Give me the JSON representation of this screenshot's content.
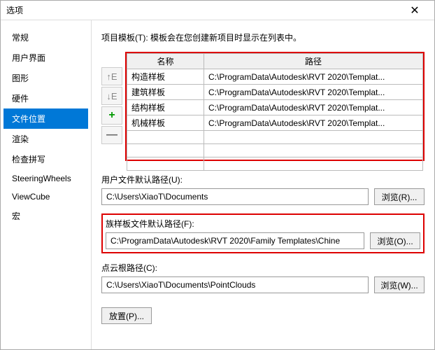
{
  "title": "选项",
  "sidebar": {
    "items": [
      {
        "label": "常规"
      },
      {
        "label": "用户界面"
      },
      {
        "label": "图形"
      },
      {
        "label": "硬件"
      },
      {
        "label": "文件位置"
      },
      {
        "label": "渲染"
      },
      {
        "label": "检查拼写"
      },
      {
        "label": "SteeringWheels"
      },
      {
        "label": "ViewCube"
      },
      {
        "label": "宏"
      }
    ]
  },
  "heading": "项目模板(T): 模板会在您创建新项目时显示在列表中。",
  "table": {
    "col_name": "名称",
    "col_path": "路径",
    "rows": [
      {
        "name": "构造样板",
        "path": "C:\\ProgramData\\Autodesk\\RVT 2020\\Templat..."
      },
      {
        "name": "建筑样板",
        "path": "C:\\ProgramData\\Autodesk\\RVT 2020\\Templat..."
      },
      {
        "name": "结构样板",
        "path": "C:\\ProgramData\\Autodesk\\RVT 2020\\Templat..."
      },
      {
        "name": "机械样板",
        "path": "C:\\ProgramData\\Autodesk\\RVT 2020\\Templat..."
      }
    ]
  },
  "buttons": {
    "up": "↑E",
    "down": "↓E",
    "add": "+",
    "remove": "—"
  },
  "user_path": {
    "label": "用户文件默认路径(U):",
    "value": "C:\\Users\\XiaoT\\Documents",
    "browse": "浏览(R)..."
  },
  "family_path": {
    "label": "族样板文件默认路径(F):",
    "value": "C:\\ProgramData\\Autodesk\\RVT 2020\\Family Templates\\Chine",
    "browse": "浏览(O)..."
  },
  "pointcloud_path": {
    "label": "点云根路径(C):",
    "value": "C:\\Users\\XiaoT\\Documents\\PointClouds",
    "browse": "浏览(W)..."
  },
  "place_btn": "放置(P)..."
}
